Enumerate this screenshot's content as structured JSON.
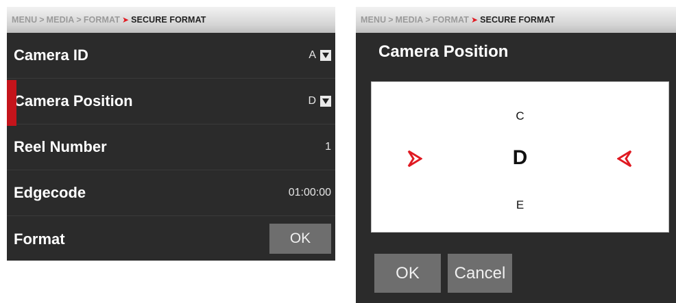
{
  "left_panel": {
    "breadcrumb": {
      "items": [
        "MENU",
        "MEDIA",
        "FORMAT"
      ],
      "current": "SECURE FORMAT"
    },
    "rows": [
      {
        "label": "Camera ID",
        "value": "A",
        "dropdown": true
      },
      {
        "label": "Camera Position",
        "value": "D",
        "dropdown": true,
        "selected": true
      },
      {
        "label": "Reel Number",
        "value": "1"
      },
      {
        "label": "Edgecode",
        "value": "01:00:00"
      },
      {
        "label": "Format",
        "button_label": "OK"
      }
    ]
  },
  "right_panel": {
    "breadcrumb": {
      "items": [
        "MENU",
        "MEDIA",
        "FORMAT"
      ],
      "current": "SECURE FORMAT"
    },
    "dialog_title": "Camera Position",
    "picker": {
      "previous": "C",
      "current": "D",
      "next": "E"
    },
    "buttons": {
      "ok": "OK",
      "cancel": "Cancel"
    }
  },
  "colors": {
    "accent": "#c4141b",
    "panel_bg": "#2b2b2b",
    "button_bg": "#6e6e6e",
    "breadcrumb_bg": "#d4d4d4"
  },
  "icons": {
    "dropdown": "dropdown-arrow-icon",
    "picker_left": "picker-left-arrow-icon",
    "picker_right": "picker-right-arrow-icon",
    "breadcrumb_arrow": "breadcrumb-chevron-icon"
  }
}
